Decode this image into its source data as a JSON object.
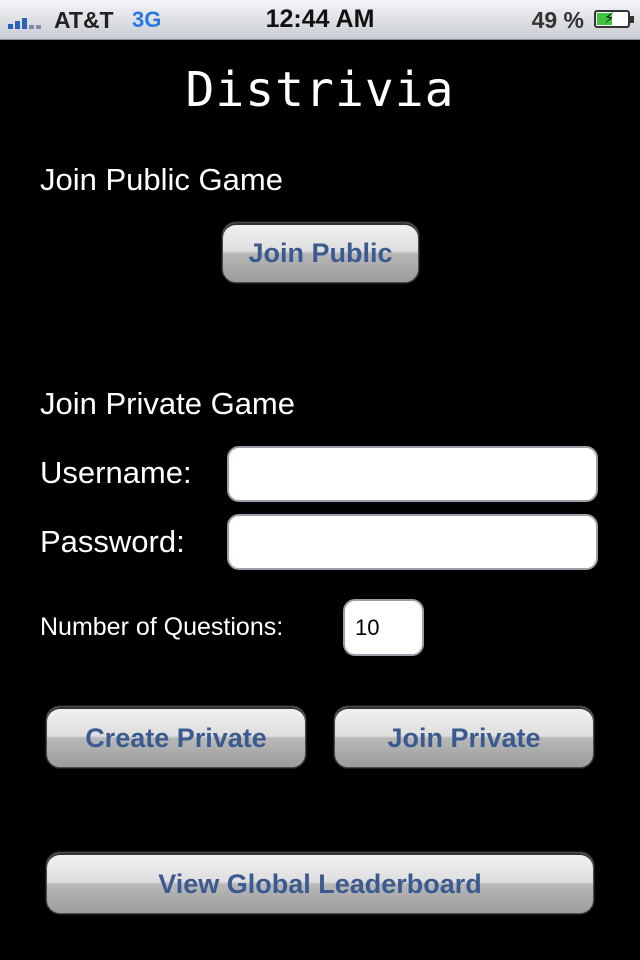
{
  "status_bar": {
    "carrier": "AT&T",
    "network": "3G",
    "time": "12:44 AM",
    "battery": "49 %",
    "battery_level": 0.49
  },
  "app": {
    "logo": "Distrivia"
  },
  "public_game": {
    "title": "Join Public Game",
    "button_label": "Join Public"
  },
  "private_game": {
    "title": "Join Private Game",
    "username_label": "Username:",
    "username_value": "",
    "password_label": "Password:",
    "password_value": "",
    "questions_label": "Number of Questions:",
    "questions_value": "10",
    "create_button_label": "Create Private",
    "join_button_label": "Join Private"
  },
  "leaderboard": {
    "button_label": "View Global Leaderboard"
  },
  "colors": {
    "background": "#000000",
    "button_text": "#3b5a8f",
    "network_text": "#2a78e4"
  }
}
